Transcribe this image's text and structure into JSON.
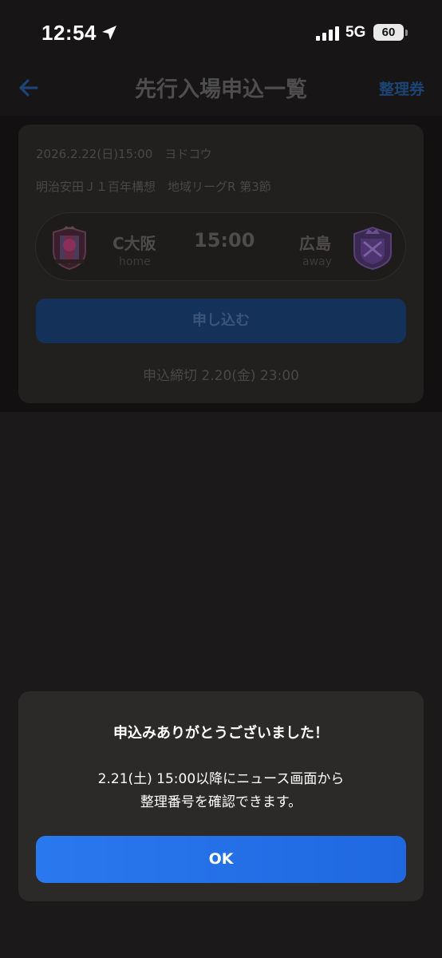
{
  "status_bar": {
    "time": "12:54",
    "network": "5G",
    "battery": "60"
  },
  "nav": {
    "title": "先行入場申込一覧",
    "right_link": "整理券"
  },
  "match": {
    "date": "2026.2.22(日)15:00　ヨドコウ",
    "competition": "明治安田Ｊ１百年構想　地域リーグR 第3節",
    "home_team": "C大阪",
    "home_label": "home",
    "away_team": "広島",
    "away_label": "away",
    "kickoff": "15:00",
    "apply_label": "申し込む",
    "deadline": "申込締切 2.20(金) 23:00"
  },
  "dialog": {
    "title": "申込みありがとうございました！",
    "message_line1": "2.21(土) 15:00以降にニュース画面から",
    "message_line2": "整理番号を確認できます。",
    "ok_label": "OK"
  },
  "colors": {
    "accent": "#2a78ee",
    "background": "#1b1919",
    "home_emblem": "#b23a6a",
    "away_emblem": "#6a3c95"
  }
}
